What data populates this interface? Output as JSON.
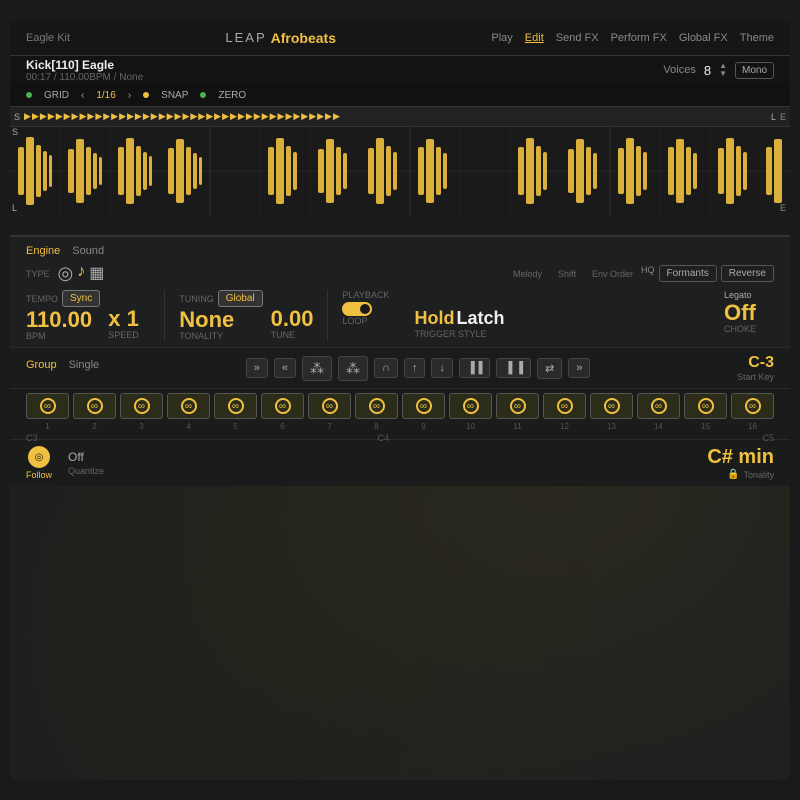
{
  "app": {
    "title_leap": "LEAP",
    "title_name": "Afrobeats"
  },
  "nav": {
    "kit_name": "Eagle Kit",
    "tabs": [
      "Play",
      "Edit",
      "Send FX",
      "Perform FX",
      "Global FX",
      "Theme"
    ],
    "active_tab": "Edit"
  },
  "track": {
    "name": "Kick[110] Eagle",
    "time": "00:17",
    "bpm": "110.00BPM",
    "key": "None",
    "voices_label": "Voices",
    "voices_num": "8",
    "mono_label": "Mono"
  },
  "grid": {
    "grid_label": "GRID",
    "snap_label": "SNAP",
    "zero_label": "ZERO",
    "division": "1/16"
  },
  "engine": {
    "section_tabs": [
      "Engine",
      "Sound"
    ],
    "active_tab": "Engine",
    "type_label": "TYPE",
    "hq_label": "HQ",
    "formants_label": "Formants",
    "reverse_label": "Reverse",
    "tempo_label": "TEMPO",
    "sync_label": "Sync",
    "tuning_label": "TUNING",
    "global_label": "Global",
    "playback_label": "PLAYBACK",
    "legato_label": "Legato",
    "bpm_val": "110.00",
    "bpm_unit": "BPM",
    "speed_val": "x 1",
    "speed_unit": "Speed",
    "tonality_val": "None",
    "tonality_label": "Tonality",
    "tune_val": "0.00",
    "tune_label": "Tune",
    "loop_label": "Loop",
    "hold_label": "Hold",
    "latch_label": "Latch",
    "trigger_label": "Trigger Style",
    "choke_val": "Off",
    "choke_label": "Choke",
    "melody_label": "Melody",
    "shift_label": "Shift",
    "env_order_label": "Env Order"
  },
  "group": {
    "tabs": [
      "Group",
      "Single"
    ],
    "active_tab": "Group",
    "controls": [
      "»",
      "«",
      "❋",
      "❋",
      "∩",
      "↑",
      "↓",
      "▐▐",
      "▐▐",
      "⇄",
      "»"
    ]
  },
  "pads": {
    "nums": [
      "1",
      "2",
      "3",
      "4",
      "5",
      "6",
      "7",
      "8",
      "9",
      "10",
      "11",
      "12",
      "13",
      "14",
      "15",
      "16"
    ],
    "c3_label": "C3",
    "c4_label": "C4",
    "c5_label": "C5"
  },
  "bottom": {
    "follow_label": "Follow",
    "quantize_val": "Off",
    "quantize_label": "Quantize",
    "start_key_val": "C-3",
    "start_key_label": "Start Key",
    "tonality_val": "C# min",
    "tonality_label": "Tonality"
  },
  "colors": {
    "accent": "#f0c040",
    "bg_dark": "#1a1b1b",
    "bg_mid": "#222",
    "text_dim": "#666",
    "text_light": "#eee"
  }
}
